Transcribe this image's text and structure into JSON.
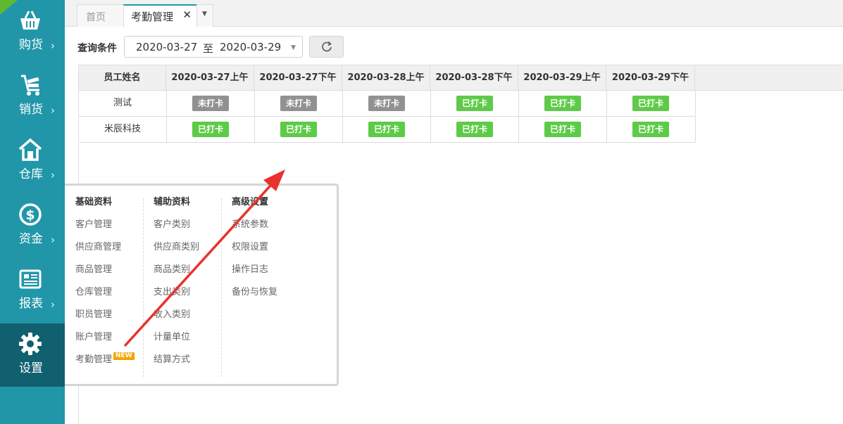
{
  "sidebar": {
    "items": [
      {
        "label": "购货",
        "icon": "basket-icon"
      },
      {
        "label": "销货",
        "icon": "cart-icon"
      },
      {
        "label": "仓库",
        "icon": "warehouse-icon"
      },
      {
        "label": "资金",
        "icon": "dollar-icon"
      },
      {
        "label": "报表",
        "icon": "report-icon"
      },
      {
        "label": "设置",
        "icon": "gear-icon"
      }
    ],
    "active_index": 5
  },
  "tabs": {
    "home": "首页",
    "active": "考勤管理",
    "close": "✕",
    "more": "▼"
  },
  "query": {
    "label": "查询条件",
    "start_date": "2020-03-27",
    "separator": "至",
    "end_date": "2020-03-29",
    "dropdown": "▼"
  },
  "table": {
    "columns": [
      "员工姓名",
      "2020-03-27上午",
      "2020-03-27下午",
      "2020-03-28上午",
      "2020-03-28下午",
      "2020-03-29上午",
      "2020-03-29下午"
    ],
    "rows": [
      {
        "name": "测试",
        "status": [
          "未打卡",
          "未打卡",
          "未打卡",
          "已打卡",
          "已打卡",
          "已打卡"
        ]
      },
      {
        "name": "米辰科技",
        "status": [
          "已打卡",
          "已打卡",
          "已打卡",
          "已打卡",
          "已打卡",
          "已打卡"
        ]
      }
    ]
  },
  "menu": {
    "basic": {
      "title": "基础资料",
      "items": [
        "客户管理",
        "供应商管理",
        "商品管理",
        "仓库管理",
        "职员管理",
        "账户管理",
        "考勤管理"
      ]
    },
    "aux": {
      "title": "辅助资料",
      "items": [
        "客户类别",
        "供应商类别",
        "商品类别",
        "支出类别",
        "收入类别",
        "计量单位",
        "结算方式"
      ]
    },
    "advanced": {
      "title": "高级设置",
      "items": [
        "系统参数",
        "权限设置",
        "操作日志",
        "备份与恢复"
      ]
    },
    "new_tag": "NEW"
  },
  "colors": {
    "sidebar": "#2196a9",
    "sidebar_active": "#10606f",
    "checked_in": "#5ecb48",
    "not_checked_in": "#919191",
    "annotation_arrow": "#e8322e"
  }
}
